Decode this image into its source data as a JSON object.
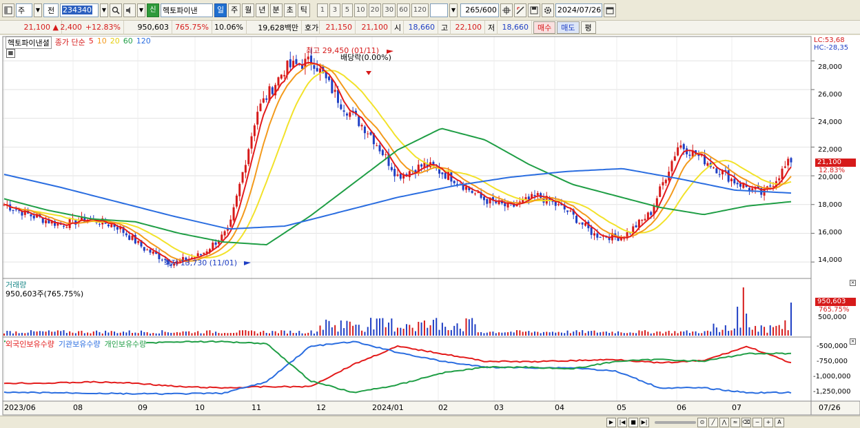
{
  "toolbar": {
    "mode": "주",
    "prev": "전",
    "code": "234340",
    "label_new": "신",
    "stock_name": "헥토파이낸",
    "periods": [
      "일",
      "주",
      "월",
      "년",
      "분",
      "초",
      "틱"
    ],
    "intervals": [
      "1",
      "3",
      "5",
      "10",
      "20",
      "30",
      "60",
      "120"
    ],
    "count": "265",
    "total": "/600",
    "date": "2024/07/26"
  },
  "info": {
    "price": "21,100",
    "change": "2,400",
    "change_pct": "+12.83%",
    "volume": "950,603",
    "vol_ratio": "765.75%",
    "turnover": "10.06%",
    "amount": "19,628백만",
    "hoga_label": "호가",
    "ask": "21,150",
    "bid": "21,100",
    "open_label": "시",
    "open": "18,660",
    "high_label": "고",
    "high": "22,100",
    "low_label": "저",
    "low": "18,660",
    "buy": "매수",
    "sell": "매도",
    "eval": "평"
  },
  "price_panel": {
    "name": "헥토파이낸셜",
    "ma_prefix": "종가 단순",
    "ma": [
      {
        "label": "5",
        "color": "#e31b1b"
      },
      {
        "label": "10",
        "color": "#f39a1c"
      },
      {
        "label": "20",
        "color": "#f2e22a"
      },
      {
        "label": "60",
        "color": "#1f9e45"
      },
      {
        "label": "120",
        "color": "#2a6de0"
      }
    ],
    "lc": "LC:53,68",
    "hc": "HC:-28,35",
    "high_note": "최고 29,450 (01/11)",
    "div_note": "배당락(0.00%)",
    "low_note": "최저 13,730 (11/01)",
    "cur_price": "21,100",
    "cur_pct": "12.83%",
    "y_ticks": [
      "28,000",
      "26,000",
      "24,000",
      "22,000",
      "20,000",
      "18,000",
      "16,000",
      "14,000"
    ]
  },
  "volume_panel": {
    "title": "거래량",
    "value": "950,603주(765.75%)",
    "tick": "500,000",
    "cur": "950,603",
    "cur_pct": "765.75%"
  },
  "holdings_panel": {
    "series": [
      {
        "label": "외국인보유수량",
        "color": "#e31b1b"
      },
      {
        "label": "기관보유수량",
        "color": "#2a6de0"
      },
      {
        "label": "개인보유수량",
        "color": "#1f9e45"
      }
    ],
    "y_ticks": [
      "-500,000",
      "-750,000",
      "-1,000,000",
      "-1,250,000"
    ]
  },
  "x_axis": {
    "labels": [
      "2023/06",
      "08",
      "09",
      "10",
      "11",
      "12",
      "2024/01",
      "02",
      "03",
      "04",
      "05",
      "06",
      "07"
    ],
    "end": "07/26"
  },
  "chart_data": {
    "type": "line",
    "x_months": [
      "2023/06",
      "2023/08",
      "2023/09",
      "2023/10",
      "2023/11",
      "2023/12",
      "2024/01",
      "2024/02",
      "2024/03",
      "2024/04",
      "2024/05",
      "2024/06",
      "2024/07"
    ],
    "close_path": [
      18000,
      17200,
      16600,
      17000,
      16500,
      14900,
      13900,
      14500,
      16200,
      24500,
      27500,
      28000,
      25000,
      23000,
      20000,
      20800,
      19800,
      18400,
      17800,
      18600,
      17600,
      15900,
      15700,
      17400,
      22200,
      21000,
      19600,
      18700,
      21100
    ],
    "ma60_path": [
      18400,
      17600,
      17000,
      16800,
      16000,
      15400,
      15200,
      17200,
      19500,
      21800,
      23300,
      22500,
      20800,
      19400,
      18600,
      17800,
      17300,
      17900,
      18200
    ],
    "ma120_path": [
      20100,
      19200,
      18200,
      17200,
      16300,
      16500,
      17500,
      18500,
      19300,
      19900,
      20300,
      20500,
      19800,
      19000,
      18800
    ],
    "high": {
      "price": 29450,
      "date": "01/11"
    },
    "low": {
      "price": 13730,
      "date": "11/01"
    },
    "last": {
      "price": 21100,
      "pct": 12.83,
      "volume": 950603,
      "vol_pct": 765.75
    },
    "y_range": [
      13000,
      29500
    ]
  }
}
